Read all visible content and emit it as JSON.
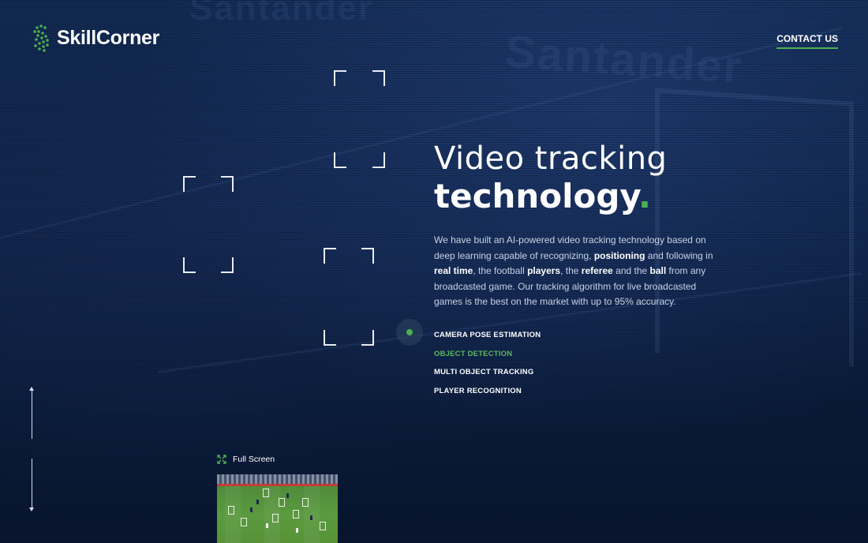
{
  "brand": {
    "name": "SkillCorner",
    "accent": "#4caf50"
  },
  "header": {
    "contact_label": "CONTACT US"
  },
  "background": {
    "sponsor_text_1": "Santander",
    "sponsor_text_2": "Santander"
  },
  "hero": {
    "title_light": "Video tracking",
    "title_bold": "technology",
    "title_dot": ".",
    "description_parts": [
      "We have built an AI-powered video tracking technology based on deep learning capable of recognizing, ",
      "positioning",
      " and following in ",
      "real time",
      ", the football ",
      "players",
      ", the ",
      "referee",
      " and the ",
      "ball",
      " from any broadcasted game. Our tracking algorithm for live broadcasted games is the best on the market with up to 95% accuracy."
    ],
    "features": [
      {
        "label": "CAMERA POSE ESTIMATION",
        "active": false
      },
      {
        "label": "OBJECT DETECTION",
        "active": true
      },
      {
        "label": "MULTI OBJECT TRACKING",
        "active": false
      },
      {
        "label": "PLAYER RECOGNITION",
        "active": false
      }
    ]
  },
  "video": {
    "fullscreen_label": "Full Screen"
  },
  "icons": {
    "logo": "skillcorner-logo-icon",
    "fullscreen": "expand-icon",
    "scroll_up": "arrow-up-icon",
    "scroll_down": "arrow-down-icon"
  }
}
